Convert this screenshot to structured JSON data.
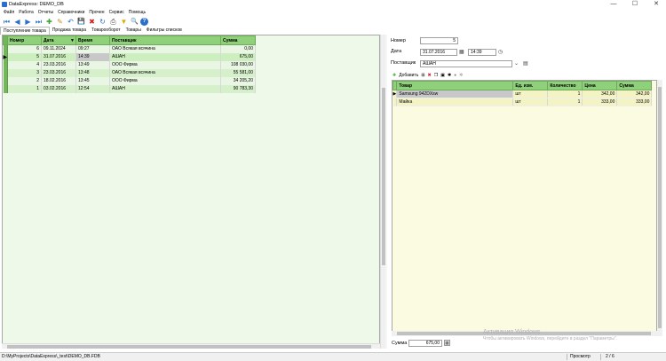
{
  "window": {
    "title": "DataExpress: DEMO_DB",
    "minimize": "—",
    "maximize": "☐",
    "close": "✕"
  },
  "menu": [
    "Файл",
    "Работа",
    "Отчеты",
    "Справочники",
    "Прочее",
    "Сервис",
    "Помощь"
  ],
  "toolbar": {
    "first": "⏮",
    "prev": "◀",
    "next": "▶",
    "last": "⏭",
    "add": "✚",
    "edit": "✎",
    "undo": "↶",
    "save": "💾",
    "delete": "✖",
    "refresh": "↻",
    "print": "⎙",
    "filter": "▼",
    "search": "🔍",
    "help": "?"
  },
  "tabs": [
    {
      "label": "Поступление товара",
      "active": true
    },
    {
      "label": "Продажа товара",
      "active": false
    },
    {
      "label": "Товарооборот",
      "active": false
    },
    {
      "label": "Товары",
      "active": false
    },
    {
      "label": "Фильтры списков",
      "active": false
    }
  ],
  "main_grid": {
    "columns": [
      "Номер",
      "Дата",
      "Время",
      "Поставщик",
      "Сумма"
    ],
    "rows": [
      {
        "num": "6",
        "date": "09.11.2024",
        "time": "09:27",
        "supplier": "ОАО Всякая всячина",
        "sum": "0,00",
        "current": false
      },
      {
        "num": "5",
        "date": "31.07.2016",
        "time": "14:39",
        "supplier": "АШАН",
        "sum": "675,00",
        "current": true
      },
      {
        "num": "4",
        "date": "23.03.2016",
        "time": "13:49",
        "supplier": "ООО Фирма",
        "sum": "108 030,00",
        "current": false
      },
      {
        "num": "3",
        "date": "23.03.2016",
        "time": "13:48",
        "supplier": "ОАО Всякая всячина",
        "sum": "55 581,00",
        "current": false
      },
      {
        "num": "2",
        "date": "18.02.2016",
        "time": "13:45",
        "supplier": "ООО Фирма",
        "sum": "34 205,20",
        "current": false
      },
      {
        "num": "1",
        "date": "03.02.2016",
        "time": "12:54",
        "supplier": "АШАН",
        "sum": "90 783,30",
        "current": false
      }
    ]
  },
  "form": {
    "number_label": "Номер",
    "number_value": "5",
    "date_label": "Дата",
    "date_value": "31.07.2016",
    "time_value": "14:39",
    "supplier_label": "Поставщик",
    "supplier_value": "АШАН",
    "add_label": "Добавить",
    "total_label": "Сумма",
    "total_value": "675,00"
  },
  "items_grid": {
    "columns": [
      "Товар",
      "Ед. изм.",
      "Количество",
      "Цена",
      "Сумма"
    ],
    "rows": [
      {
        "item": "Samsung 942DXsw",
        "unit": "шт",
        "qty": "1",
        "price": "342,00",
        "sum": "342,00",
        "current": true
      },
      {
        "item": "Майка",
        "unit": "шт",
        "qty": "1",
        "price": "333,00",
        "sum": "333,00",
        "current": false
      }
    ]
  },
  "watermark": {
    "line1": "Активация Windows",
    "line2": "Чтобы активировать Windows, перейдите в раздел \"Параметры\"."
  },
  "status": {
    "path": "D:\\MyProjects\\DataExpress\\_test\\DEMO_DB.FDB",
    "mode": "Просмотр",
    "position": "2 / 6"
  },
  "colors": {
    "header_green": "#8fd17a",
    "grid_bg": "#eef9ea",
    "items_bg": "#fbfbe2",
    "toolbar_blue": "#2a6fc9"
  }
}
